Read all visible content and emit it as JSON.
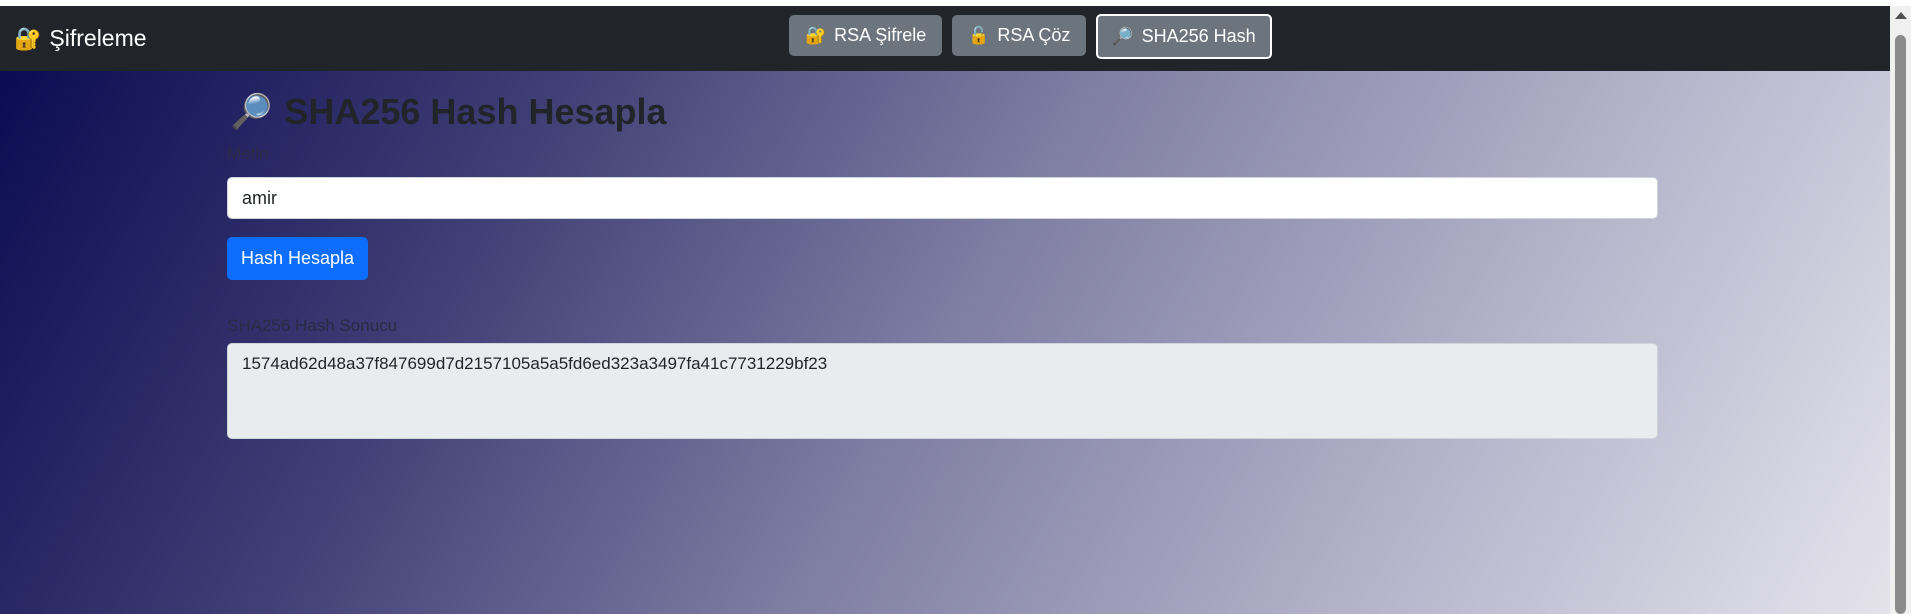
{
  "navbar": {
    "brand": {
      "icon": "lock-icon",
      "icon_glyph": "🔐",
      "label": "Şifreleme"
    },
    "buttons": [
      {
        "icon": "lock-icon",
        "icon_glyph": "🔐",
        "label": "RSA Şifrele",
        "active": false
      },
      {
        "icon": "unlock-icon",
        "icon_glyph": "🔓",
        "label": "RSA Çöz",
        "active": false
      },
      {
        "icon": "magnifier-icon",
        "icon_glyph": "🔎",
        "label": "SHA256 Hash",
        "active": true
      }
    ]
  },
  "main": {
    "title_icon_glyph": "🔎",
    "title": "SHA256 Hash Hesapla",
    "input_label": "Metin",
    "input_value": "amir",
    "submit_label": "Hash Hesapla",
    "result_label": "SHA256 Hash Sonucu",
    "result_value": "1574ad62d48a37f847699d7d2157105a5a5fd6ed323a3497fa41c7731229bf23"
  },
  "colors": {
    "navbar_bg": "#212529",
    "nav_button_bg": "#6c757d",
    "primary": "#0d6efd",
    "gradient_start": "#0b0b52",
    "gradient_end": "#e4e3ec"
  }
}
